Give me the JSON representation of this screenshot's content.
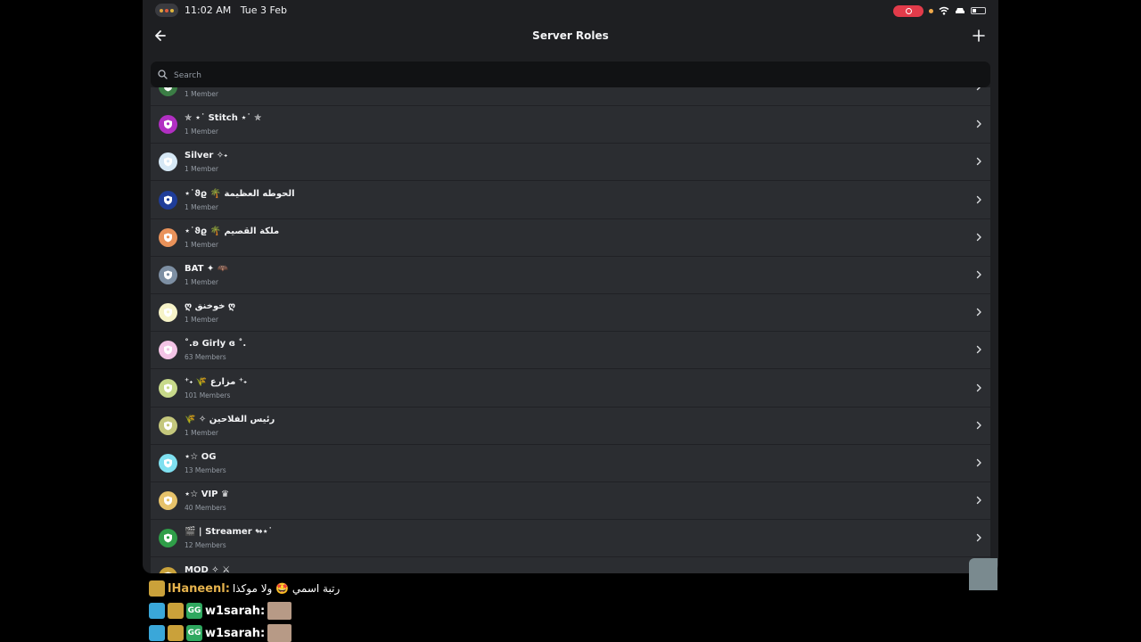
{
  "status_bar": {
    "time": "11:02 AM",
    "date": "Tue 3 Feb",
    "dots": [
      "#e0a53c",
      "#e05b3c",
      "#e0b53c"
    ],
    "record_color": "#e23b4a"
  },
  "header": {
    "title": "Server Roles",
    "back_icon": "arrow-left-icon",
    "add_icon": "plus-icon"
  },
  "search": {
    "placeholder": "Search"
  },
  "roles": [
    {
      "name": "",
      "count": "1 Member",
      "color": "#3b7d45"
    },
    {
      "name": "✯ ⋆˙ Stitch ⋆˙ ✯",
      "count": "1 Member",
      "color": "#b12fc2"
    },
    {
      "name": "Silver ✧˖",
      "count": "1 Member",
      "color": "#d6e8f5"
    },
    {
      "name": "⋆˙ϑϱ 🌴 الحوطه العظيمة",
      "count": "1 Member",
      "color": "#1f3d99"
    },
    {
      "name": "⋆˙ϑϱ 🌴 ملكة القصيم",
      "count": "1 Member",
      "color": "#e9925a"
    },
    {
      "name": "BAT ✦ 🦇",
      "count": "1 Member",
      "color": "#7d8fa3"
    },
    {
      "name": "ღ خوخنق ღ",
      "count": "1 Member",
      "color": "#f6f3c8"
    },
    {
      "name": "˚.ʚ Girly ɞ ˚.",
      "count": "63 Members",
      "color": "#f3c4e6"
    },
    {
      "name": "⁺˖ 🌾 مزارع ⁺˖",
      "count": "101 Members",
      "color": "#c7d98a"
    },
    {
      "name": "🌾 ✧ رئيس الفلاحين",
      "count": "1 Member",
      "color": "#c4c77c"
    },
    {
      "name": "⋆☆ OG",
      "count": "13 Members",
      "color": "#7fe0f0"
    },
    {
      "name": "⋆☆ VIP ♛",
      "count": "40 Members",
      "color": "#e6c26a"
    },
    {
      "name": "🎬 | Streamer ↬⋆˙",
      "count": "12 Members",
      "color": "#2f9e48"
    },
    {
      "name": "MOD ✧ ⚔",
      "count": "",
      "color": "#c9a23b"
    }
  ],
  "chat": [
    {
      "user": "lHaneenl:",
      "message": "رتبة اسمي 🤩 ولا موكذا",
      "user_color": "#e6b34d"
    },
    {
      "user": "w1sarah:",
      "message": "",
      "user_color": "#ffffff"
    },
    {
      "user": "w1sarah:",
      "message": "",
      "user_color": "#ffffff"
    }
  ]
}
